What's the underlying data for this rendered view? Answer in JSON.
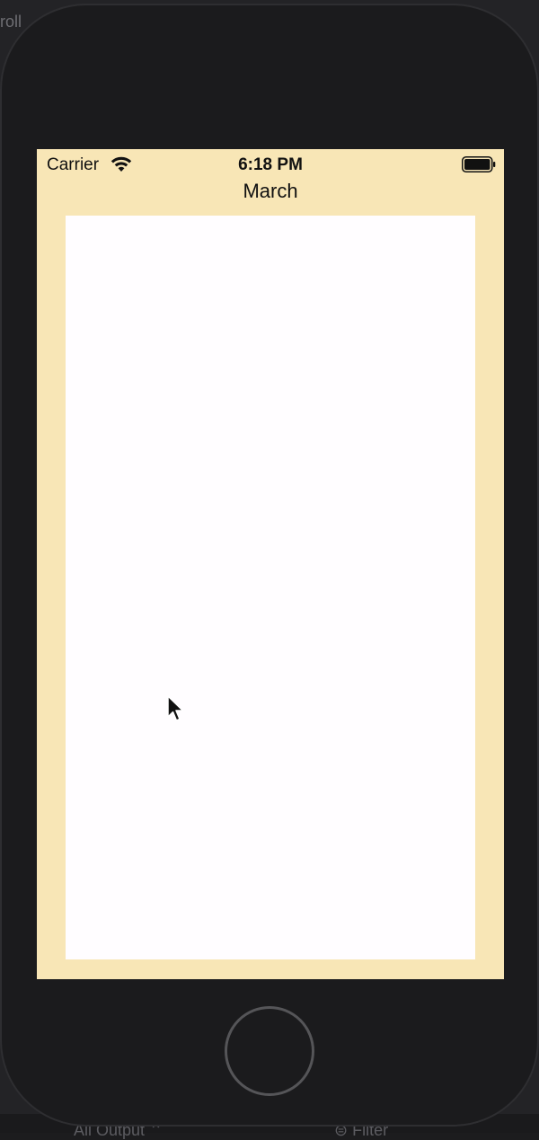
{
  "background_text": {
    "top_left_fragment": "roll",
    "bottom_left_fragment": "All Output ⌃",
    "bottom_right_fragment": "⊜ Filter"
  },
  "status_bar": {
    "carrier": "Carrier",
    "time": "6:18 PM",
    "wifi_icon": "wifi-icon",
    "battery_icon": "battery-icon"
  },
  "navigation": {
    "title": "March"
  },
  "colors": {
    "screen_background": "#f8e6b6",
    "content_background": "#fffdff",
    "device_body": "#1b1b1d"
  }
}
